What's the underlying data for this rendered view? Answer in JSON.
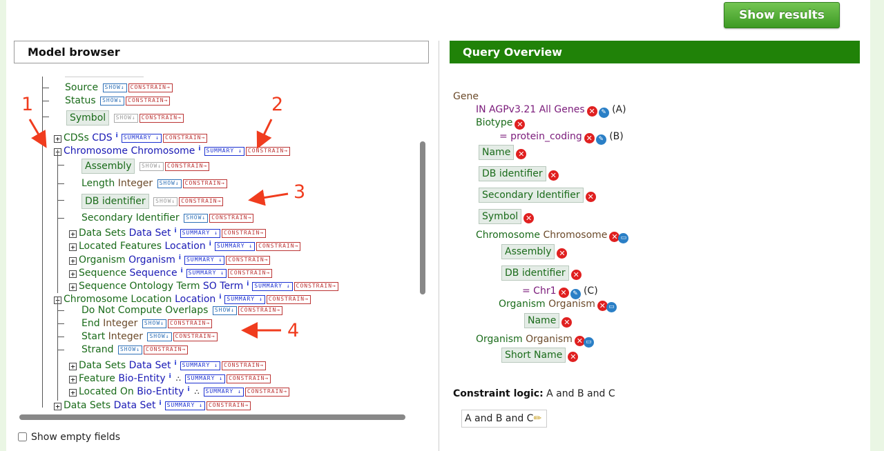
{
  "toolbar": {
    "show_results": "Show results"
  },
  "model_browser": {
    "title": "Model browser",
    "show_empty_fields": "Show empty fields",
    "show_empty_checked": false,
    "buttons": {
      "show": "SHOW↓",
      "summary": "SUMMARY ↓",
      "constrain": "CONSTRAIN→",
      "info": "i"
    },
    "rows": [
      {
        "name": "Source",
        "type": "",
        "kind": "attr"
      },
      {
        "name": "Status",
        "type": "",
        "kind": "attr"
      },
      {
        "name": "Symbol",
        "type": "",
        "kind": "attr",
        "selected": true
      },
      {
        "name": "CDSs",
        "type": "CDS",
        "kind": "ref",
        "expander": "+"
      },
      {
        "name": "Chromosome",
        "type": "Chromosome",
        "kind": "ref",
        "expander": "−"
      },
      {
        "name": "Assembly",
        "type": "",
        "kind": "attr",
        "selected": true
      },
      {
        "name": "Length",
        "type": "Integer",
        "kind": "attr"
      },
      {
        "name": "DB identifier",
        "type": "",
        "kind": "attr",
        "selected": true
      },
      {
        "name": "Secondary Identifier",
        "type": "",
        "kind": "attr"
      },
      {
        "name": "Data Sets",
        "type": "Data Set",
        "kind": "ref",
        "expander": "+"
      },
      {
        "name": "Located Features",
        "type": "Location",
        "kind": "ref",
        "expander": "+"
      },
      {
        "name": "Organism",
        "type": "Organism",
        "kind": "ref",
        "expander": "+"
      },
      {
        "name": "Sequence",
        "type": "Sequence",
        "kind": "ref",
        "expander": "+"
      },
      {
        "name": "Sequence Ontology Term",
        "type": "SO Term",
        "kind": "ref",
        "expander": "+"
      },
      {
        "name": "Chromosome Location",
        "type": "Location",
        "kind": "ref",
        "expander": "−"
      },
      {
        "name": "Do Not Compute Overlaps",
        "type": "",
        "kind": "attr"
      },
      {
        "name": "End",
        "type": "Integer",
        "kind": "attr"
      },
      {
        "name": "Start",
        "type": "Integer",
        "kind": "attr"
      },
      {
        "name": "Strand",
        "type": "",
        "kind": "attr"
      },
      {
        "name": "Data Sets",
        "type": "Data Set",
        "kind": "ref",
        "expander": "+"
      },
      {
        "name": "Feature",
        "type": "Bio-Entity",
        "kind": "ref",
        "expander": "+"
      },
      {
        "name": "Located On",
        "type": "Bio-Entity",
        "kind": "ref",
        "expander": "+"
      },
      {
        "name": "Data Sets",
        "type": "Data Set",
        "kind": "ref",
        "expander": "+"
      }
    ]
  },
  "query_overview": {
    "title": "Query Overview",
    "root": "Gene",
    "gene_list_constraint": {
      "text": "IN AGPv3.21 All Genes",
      "code": "(A)"
    },
    "biotype": {
      "name": "Biotype",
      "constraint": "= protein_coding",
      "code": "(B)"
    },
    "gene_fields": [
      "Name",
      "DB identifier",
      "Secondary Identifier",
      "Symbol"
    ],
    "chromosome": {
      "name": "Chromosome",
      "type": "Chromosome"
    },
    "chromosome_fields": [
      "Assembly",
      "DB identifier"
    ],
    "chr_constraint": {
      "text": "= Chr1",
      "code": "(C)"
    },
    "chr_organism": {
      "name": "Organism",
      "type": "Organism",
      "field": "Name"
    },
    "organism": {
      "name": "Organism",
      "type": "Organism",
      "field": "Short Name"
    },
    "constraint_logic_label": "Constraint logic:",
    "constraint_logic_value": "A and B and C",
    "constraint_logic_box": "A and B and C"
  },
  "annotations": [
    "1",
    "2",
    "3",
    "4"
  ],
  "colors": {
    "green_header": "#208208",
    "annotation_red": "#f03c1e",
    "show_results_green": "#4caf2c"
  }
}
